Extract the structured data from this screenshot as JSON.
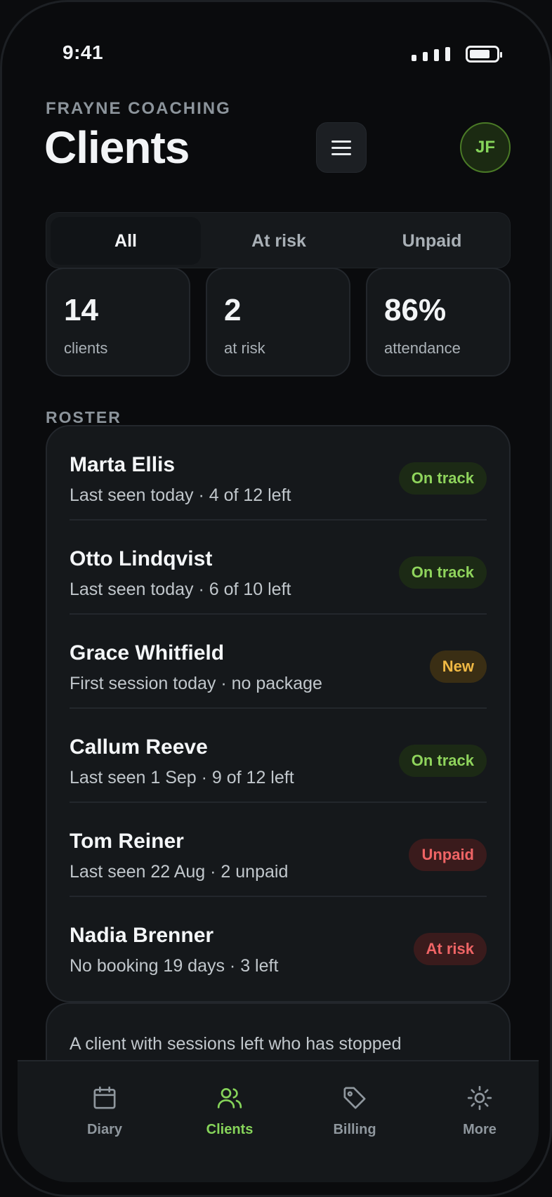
{
  "status_bar": {
    "time": "9:41"
  },
  "header": {
    "eyebrow": "FRAYNE COACHING",
    "title": "Clients",
    "avatar_initials": "JF"
  },
  "filters": [
    {
      "label": "All",
      "active": true
    },
    {
      "label": "At risk",
      "active": false
    },
    {
      "label": "Unpaid",
      "active": false
    }
  ],
  "stats": [
    {
      "value": "14",
      "label": "clients"
    },
    {
      "value": "2",
      "label": "at risk"
    },
    {
      "value": "86%",
      "label": "attendance"
    }
  ],
  "section_label": "ROSTER",
  "roster": [
    {
      "name": "Marta Ellis",
      "detail": "Last seen today · 4 of 12 left",
      "status": "On track",
      "status_type": "on-track"
    },
    {
      "name": "Otto Lindqvist",
      "detail": "Last seen today · 6 of 10 left",
      "status": "On track",
      "status_type": "on-track"
    },
    {
      "name": "Grace Whitfield",
      "detail": "First session today · no package",
      "status": "New",
      "status_type": "new"
    },
    {
      "name": "Callum Reeve",
      "detail": "Last seen 1 Sep · 9 of 12 left",
      "status": "On track",
      "status_type": "on-track"
    },
    {
      "name": "Tom Reiner",
      "detail": "Last seen 22 Aug · 2 unpaid",
      "status": "Unpaid",
      "status_type": "unpaid"
    },
    {
      "name": "Nadia Brenner",
      "detail": "No booking 19 days · 3 left",
      "status": "At risk",
      "status_type": "at-risk"
    }
  ],
  "info_text": "A client with sessions left who has stopped",
  "tabbar": [
    {
      "label": "Diary",
      "icon": "calendar-icon",
      "active": false
    },
    {
      "label": "Clients",
      "icon": "users-icon",
      "active": true
    },
    {
      "label": "Billing",
      "icon": "tag-icon",
      "active": false
    },
    {
      "label": "More",
      "icon": "sun-icon",
      "active": false
    }
  ],
  "colors": {
    "accent": "#86d45a",
    "background": "#0a0b0d",
    "card": "#15181b",
    "warning": "#f0b944",
    "danger": "#ef6465"
  }
}
